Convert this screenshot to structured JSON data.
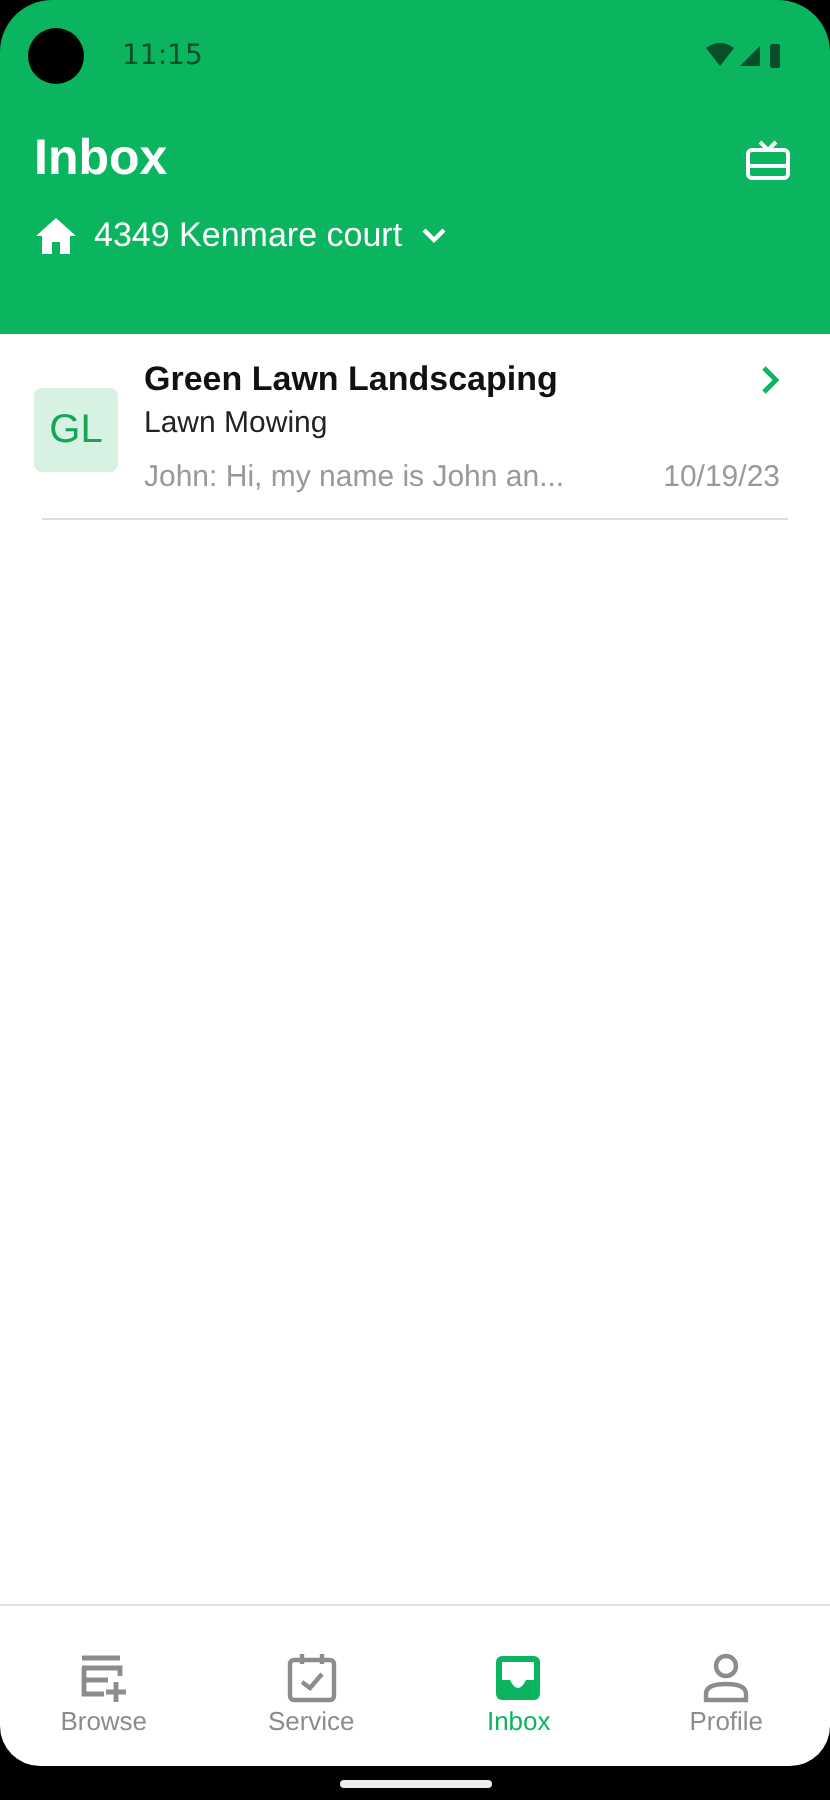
{
  "status_bar": {
    "time": "11:15"
  },
  "header": {
    "title": "Inbox",
    "address": "4349 Kenmare court"
  },
  "conversations": [
    {
      "initials": "GL",
      "name": "Green Lawn Landscaping",
      "service": "Lawn Mowing",
      "preview": "John: Hi, my name is John an...",
      "date": "10/19/23"
    }
  ],
  "nav": [
    {
      "kind": "browse",
      "label": "Browse",
      "selected": false
    },
    {
      "kind": "service",
      "label": "Service",
      "selected": false
    },
    {
      "kind": "inbox",
      "label": "Inbox",
      "selected": true
    },
    {
      "kind": "profile",
      "label": "Profile",
      "selected": false
    }
  ]
}
